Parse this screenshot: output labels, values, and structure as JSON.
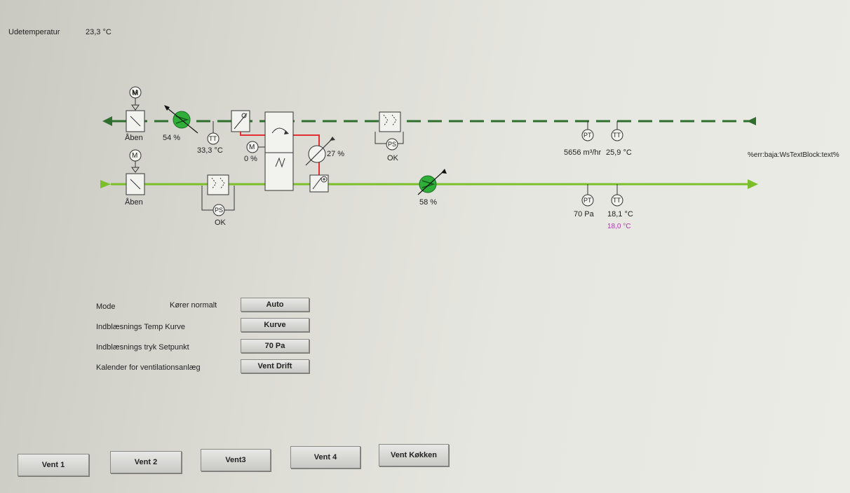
{
  "outdoor": {
    "label": "Udetemperatur",
    "value": "23,3 °C"
  },
  "diagram": {
    "exhaust_damper": {
      "label": "Åben"
    },
    "exhaust_fan": {
      "value": "54 %"
    },
    "exhaust_temp": {
      "tag": "TT",
      "value": "33,3 °C"
    },
    "exhaust_motor": {
      "tag": "M",
      "value": "0 %"
    },
    "heating_valve": {
      "value": "27 %"
    },
    "exhaust_filter_ps": {
      "tag": "PS",
      "status": "OK"
    },
    "return_pressure": {
      "tag": "PT",
      "value": "5656 m³/hr"
    },
    "return_temp": {
      "tag": "TT",
      "value": "25,9 °C"
    },
    "error_text": "%err:baja:WsTextBlock:text%",
    "supply_damper": {
      "label": "Åben"
    },
    "supply_filter_ps": {
      "tag": "PS",
      "status": "OK"
    },
    "supply_fan": {
      "value": "58 %"
    },
    "supply_pressure": {
      "tag": "PT",
      "value": "70 Pa"
    },
    "supply_temp": {
      "tag": "TT",
      "value": "18,1 °C",
      "setpoint": "18,0 °C"
    },
    "motor_tag": "M",
    "exhaust_color": "#2e6e2e",
    "supply_color": "#7bbf2a",
    "hot_color": "#e23030",
    "fan_color": "#2fae3a"
  },
  "controls": {
    "mode_label": "Mode",
    "mode_status": "Kører normalt",
    "mode_button": "Auto",
    "temp_curve_label": "Indblæsnings Temp Kurve",
    "temp_curve_button": "Kurve",
    "pressure_label": "Indblæsnings tryk Setpunkt",
    "pressure_button": "70 Pa",
    "calendar_label": "Kalender for ventilationsanlæg",
    "calendar_button": "Vent Drift"
  },
  "nav": [
    "Vent 1",
    "Vent 2",
    "Vent3",
    "Vent 4",
    "Vent Køkken"
  ]
}
